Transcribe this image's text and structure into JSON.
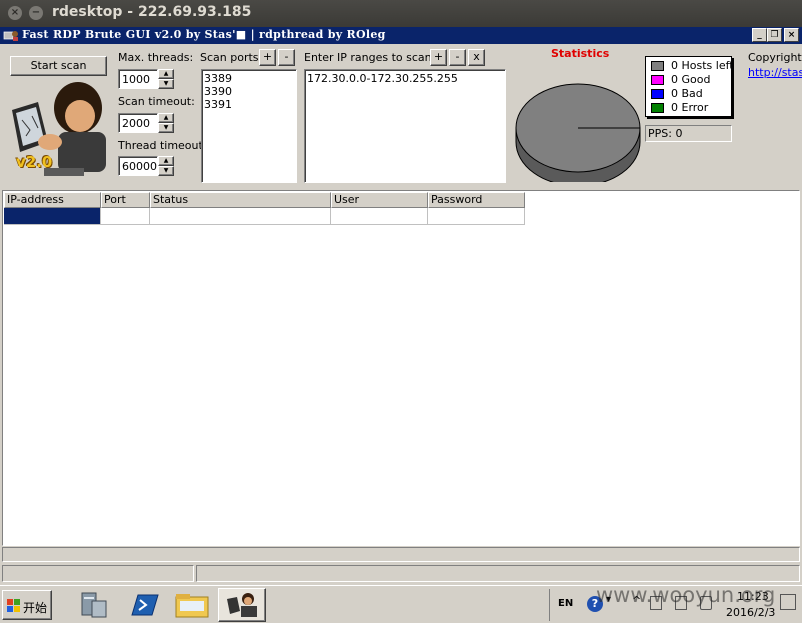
{
  "outer_window": {
    "title": "rdesktop - 222.69.93.185",
    "close_glyph": "×",
    "min_glyph": "−"
  },
  "app": {
    "title": "Fast RDP Brute GUI v2.0 by Stas'■ | rdpthread by ROleg",
    "min_glyph": "_",
    "max_glyph": "❐",
    "close_glyph": "×"
  },
  "controls": {
    "start_scan_label": "Start scan",
    "max_threads_label": "Max. threads:",
    "max_threads_value": "1000",
    "scan_timeout_label": "Scan timeout:",
    "scan_timeout_value": "2000",
    "thread_timeout_label": "Thread timeout:",
    "thread_timeout_value": "60000",
    "scan_ports_label": "Scan ports:",
    "ports": "3389\n3390\n3391",
    "ip_ranges_label": "Enter IP ranges to scan:",
    "ip_ranges": "172.30.0.0-172.30.255.255",
    "plus": "+",
    "minus": "-",
    "clear": "x",
    "logo_version": "v2.0"
  },
  "statistics": {
    "title": "Statistics",
    "title_color": "#e00000",
    "legend": [
      {
        "label": "0 Hosts left",
        "color": "#808080"
      },
      {
        "label": "0 Good",
        "color": "#ff00ff"
      },
      {
        "label": "0 Bad",
        "color": "#0000ff"
      },
      {
        "label": "0 Error",
        "color": "#008000"
      }
    ],
    "pps": "PPS: 0",
    "copyright": "Copyright ©",
    "link": "http://stas"
  },
  "grid": {
    "columns": [
      "IP-address",
      "Port",
      "Status",
      "User",
      "Password"
    ]
  },
  "taskbar": {
    "start_label": "开始",
    "lang": "EN",
    "time": "11:23",
    "date": "2016/2/3",
    "watermark": "www.wooyun.org"
  }
}
